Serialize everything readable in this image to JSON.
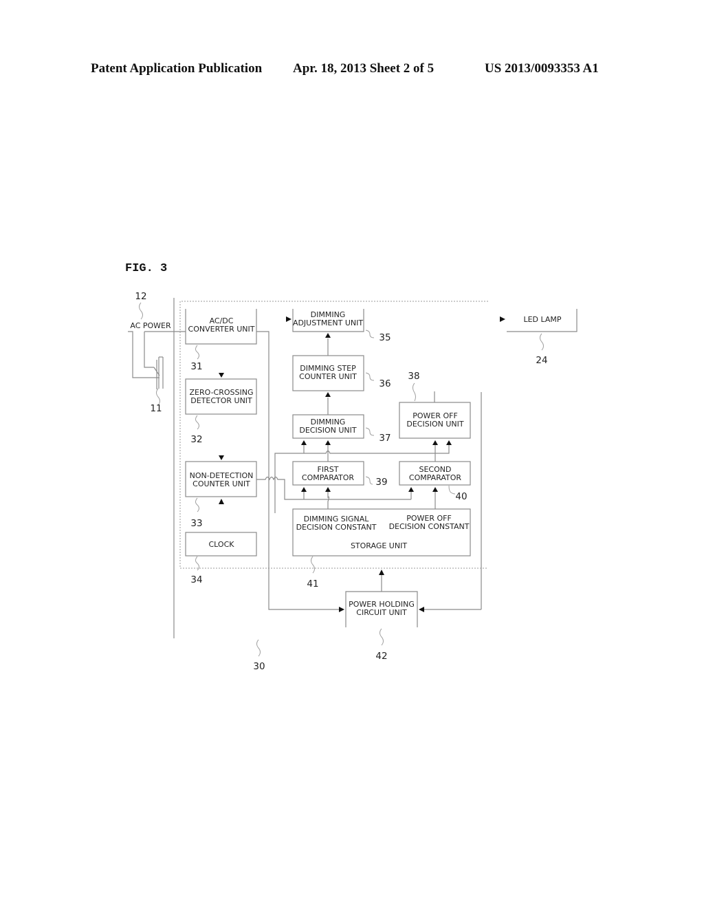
{
  "header": {
    "left": "Patent Application Publication",
    "center": "Apr. 18, 2013  Sheet 2 of 5",
    "right": "US 2013/0093353 A1"
  },
  "figure": {
    "label": "FIG. 3",
    "external": {
      "ac_power": "AC POWER",
      "led_lamp": "LED LAMP"
    },
    "blocks": {
      "acdc": [
        "AC/DC",
        "CONVERTER UNIT"
      ],
      "zero_crossing": [
        "ZERO-CROSSING",
        "DETECTOR UNIT"
      ],
      "non_detection": [
        "NON-DETECTION",
        "COUNTER UNIT"
      ],
      "clock": [
        "CLOCK"
      ],
      "dimming_adjustment": [
        "DIMMING",
        "ADJUSTMENT UNIT"
      ],
      "dimming_step": [
        "DIMMING STEP",
        "COUNTER UNIT"
      ],
      "dimming_decision": [
        "DIMMING",
        "DECISION UNIT"
      ],
      "power_off_decision": [
        "POWER OFF",
        "DECISION UNIT"
      ],
      "first_comparator": [
        "FIRST",
        "COMPARATOR"
      ],
      "second_comparator": [
        "SECOND",
        "COMPARATOR"
      ],
      "storage": {
        "left": [
          "DIMMING SIGNAL",
          "DECISION CONSTANT"
        ],
        "right": [
          "POWER OFF",
          "DECISION CONSTANT"
        ],
        "title": "STORAGE UNIT"
      },
      "power_holding": [
        "POWER HOLDING",
        "CIRCUIT UNIT"
      ]
    },
    "refs": {
      "r12": "12",
      "r11": "11",
      "r31": "31",
      "r32": "32",
      "r33": "33",
      "r34": "34",
      "r35": "35",
      "r36": "36",
      "r37": "37",
      "r38": "38",
      "r39": "39",
      "r40": "40",
      "r41": "41",
      "r42": "42",
      "r24": "24",
      "r30": "30"
    }
  }
}
